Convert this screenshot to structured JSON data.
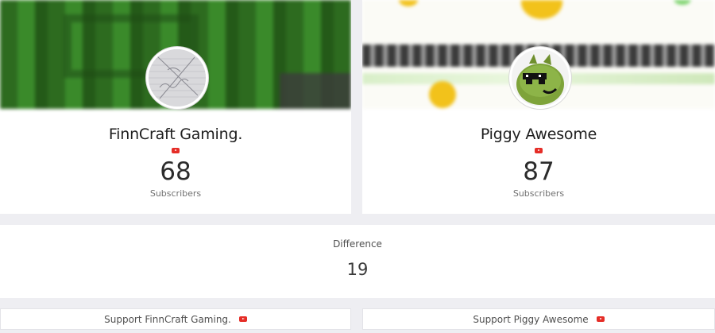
{
  "channels": [
    {
      "name": "FinnCraft Gaming.",
      "subscribers": "68",
      "subscribers_label": "Subscribers",
      "avatar_icon": "sketch-avatar-icon",
      "platform_icon": "youtube-icon"
    },
    {
      "name": "Piggy Awesome",
      "subscribers": "87",
      "subscribers_label": "Subscribers",
      "avatar_icon": "green-pig-avatar-icon",
      "platform_icon": "youtube-icon"
    }
  ],
  "difference": {
    "label": "Difference",
    "value": "19"
  },
  "support": [
    {
      "label": "Support FinnCraft Gaming.",
      "icon": "youtube-icon"
    },
    {
      "label": "Support Piggy Awesome",
      "icon": "youtube-icon"
    }
  ],
  "colors": {
    "youtube_red": "#e52d27",
    "page_background": "#eeeef2",
    "card_background": "#ffffff"
  }
}
